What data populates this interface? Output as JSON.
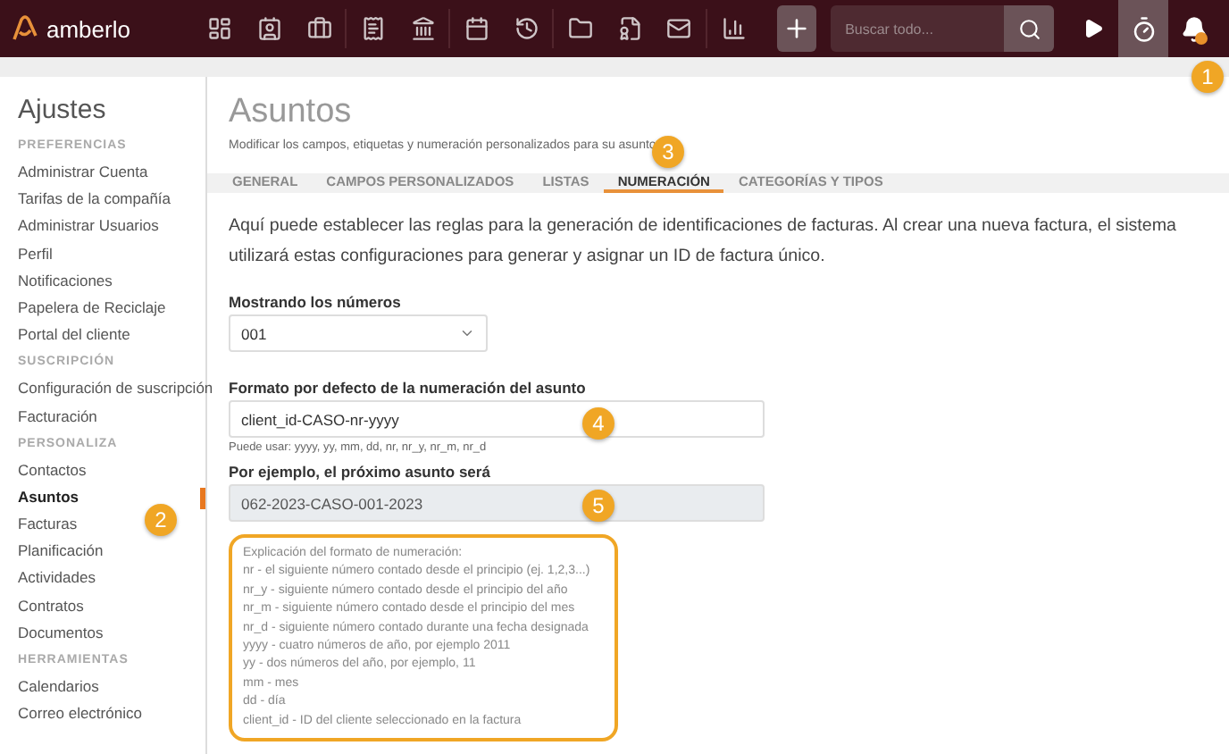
{
  "top_bar": {
    "logo": "amberlo",
    "search": {
      "placeholder": "Buscar todo..."
    },
    "notification_badge": true
  },
  "sidebar": {
    "title": "Ajustes",
    "sections": [
      {
        "heading": "PREFERENCIAS",
        "items": [
          {
            "label": "Administrar Cuenta",
            "selected": false
          },
          {
            "label": "Tarifas de la compañía",
            "selected": false
          },
          {
            "label": "Administrar Usuarios",
            "selected": false
          },
          {
            "label": "Perfil",
            "selected": false
          },
          {
            "label": "Notificaciones",
            "selected": false
          },
          {
            "label": "Papelera de Reciclaje",
            "selected": false
          },
          {
            "label": "Portal del cliente",
            "selected": false
          }
        ]
      },
      {
        "heading": "SUSCRIPCIÓN",
        "items": [
          {
            "label": "Configuración de suscripción",
            "selected": false
          },
          {
            "label": "Facturación",
            "selected": false
          }
        ]
      },
      {
        "heading": "PERSONALIZA",
        "items": [
          {
            "label": "Contactos",
            "selected": false
          },
          {
            "label": "Asuntos",
            "selected": true
          },
          {
            "label": "Facturas",
            "selected": false
          },
          {
            "label": "Planificación",
            "selected": false
          },
          {
            "label": "Actividades",
            "selected": false
          },
          {
            "label": "Contratos",
            "selected": false
          },
          {
            "label": "Documentos",
            "selected": false
          }
        ]
      },
      {
        "heading": "HERRAMIENTAS",
        "items": [
          {
            "label": "Calendarios",
            "selected": false
          },
          {
            "label": "Correo electrónico",
            "selected": false
          }
        ]
      }
    ]
  },
  "page": {
    "title": "Asuntos",
    "subtitle": "Modificar los campos, etiquetas y numeración personalizados para su asunto",
    "tabs": [
      {
        "label": "GENERAL",
        "selected": false
      },
      {
        "label": "CAMPOS PERSONALIZADOS",
        "selected": false
      },
      {
        "label": "LISTAS",
        "selected": false
      },
      {
        "label": "NUMERACIÓN",
        "selected": true
      },
      {
        "label": "CATEGORÍAS Y TIPOS",
        "selected": false
      }
    ],
    "intro": "Aquí puede establecer las reglas para la generación de identificaciones de facturas. Al crear una nueva factura, el sistema utilizará estas configuraciones para generar y asignar un ID de factura único.",
    "number_select": {
      "label": "Mostrando los números",
      "value": "001"
    },
    "format_field": {
      "label": "Formato por defecto de la numeración del asunto",
      "value": "client_id-CASO-nr-yyyy",
      "hint": "Puede usar: yyyy, yy, mm, dd, nr, nr_y, nr_m, nr_d"
    },
    "example_field": {
      "label": "Por ejemplo, el próximo asunto será",
      "value": "062-2023-CASO-001-2023",
      "disabled": true
    },
    "explanation": [
      "Explicación del formato de numeración:",
      "nr - el siguiente número contado desde el principio (ej. 1,2,3...)",
      "nr_y - siguiente número contado desde el principio del año",
      "nr_m - siguiente número contado desde el principio del mes",
      "nr_d - siguiente número contado durante una fecha designada",
      "yyyy - cuatro números de año, por ejemplo 2011",
      "yy - dos números del año, por ejemplo, 11",
      "mm - mes",
      "dd - día",
      "client_id - ID del cliente seleccionado en la factura"
    ]
  },
  "callouts": [
    "1",
    "2",
    "3",
    "4",
    "5"
  ]
}
